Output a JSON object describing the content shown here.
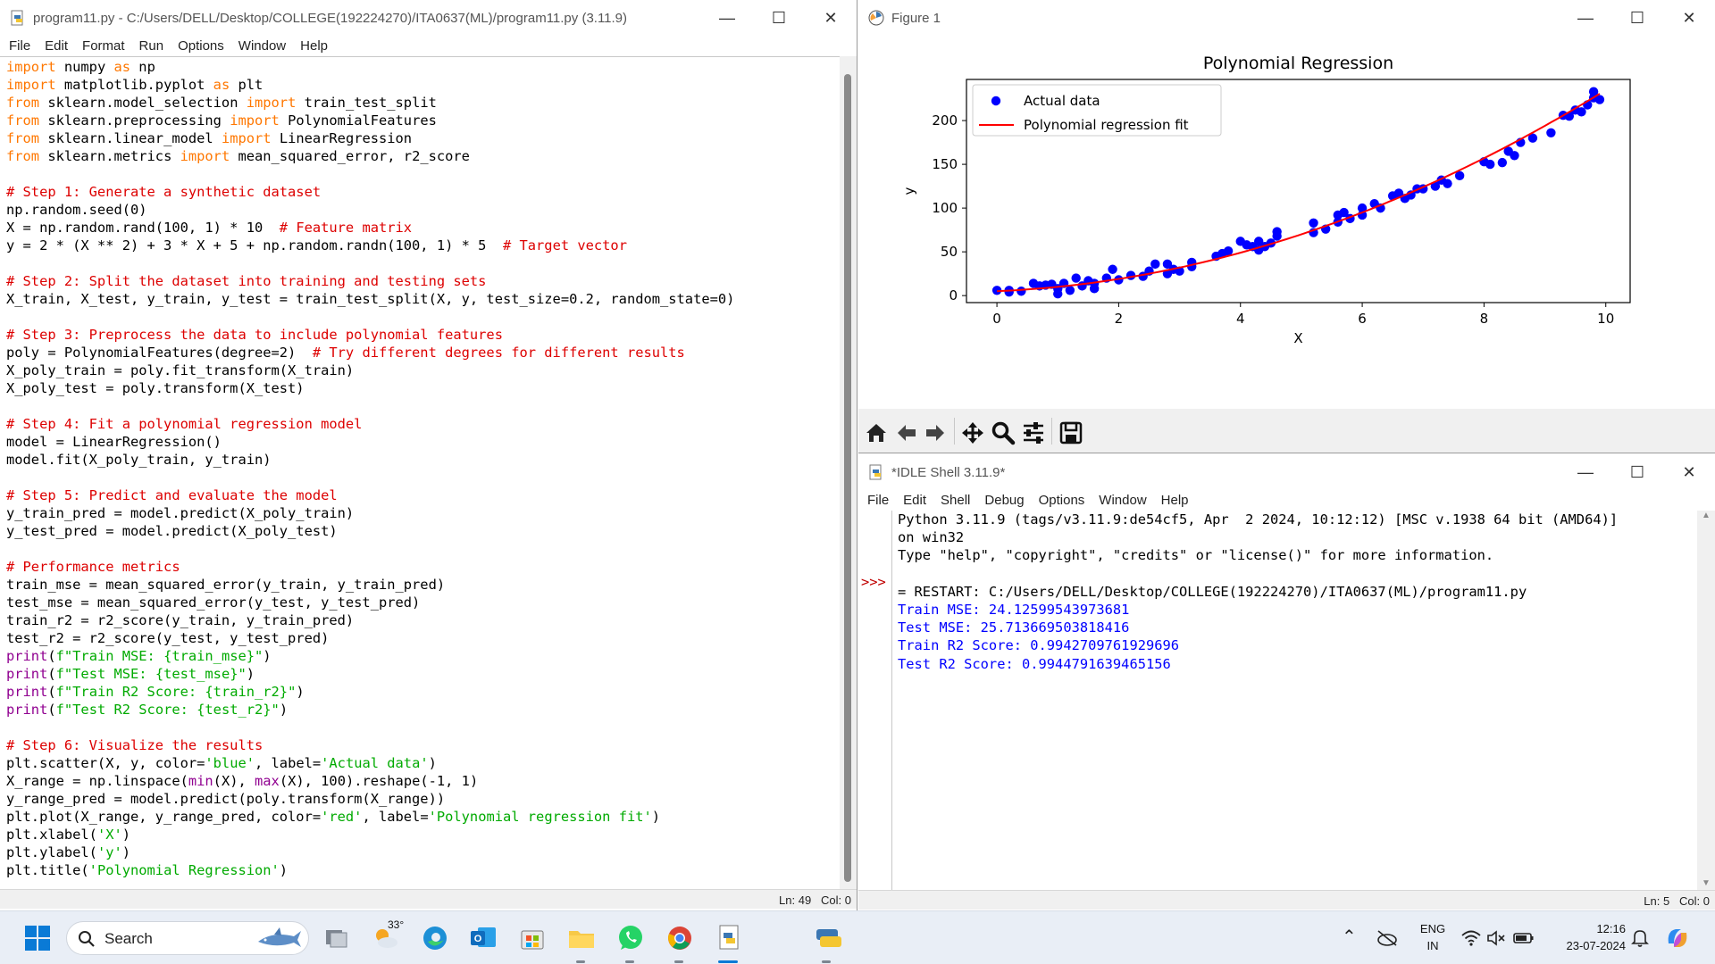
{
  "editor": {
    "title": "program11.py - C:/Users/DELL/Desktop/COLLEGE(192224270)/ITA0637(ML)/program11.py (3.11.9)",
    "menu": [
      "File",
      "Edit",
      "Format",
      "Run",
      "Options",
      "Window",
      "Help"
    ],
    "status": "Ln: 49   Col: 0",
    "code_lines": [
      [
        [
          "kw",
          "import"
        ],
        [
          "n",
          " numpy "
        ],
        [
          "kw",
          "as"
        ],
        [
          "n",
          " np"
        ]
      ],
      [
        [
          "kw",
          "import"
        ],
        [
          "n",
          " matplotlib.pyplot "
        ],
        [
          "kw",
          "as"
        ],
        [
          "n",
          " plt"
        ]
      ],
      [
        [
          "kw",
          "from"
        ],
        [
          "n",
          " sklearn.model_selection "
        ],
        [
          "kw",
          "import"
        ],
        [
          "n",
          " train_test_split"
        ]
      ],
      [
        [
          "kw",
          "from"
        ],
        [
          "n",
          " sklearn.preprocessing "
        ],
        [
          "kw",
          "import"
        ],
        [
          "n",
          " PolynomialFeatures"
        ]
      ],
      [
        [
          "kw",
          "from"
        ],
        [
          "n",
          " sklearn.linear_model "
        ],
        [
          "kw",
          "import"
        ],
        [
          "n",
          " LinearRegression"
        ]
      ],
      [
        [
          "kw",
          "from"
        ],
        [
          "n",
          " sklearn.metrics "
        ],
        [
          "kw",
          "import"
        ],
        [
          "n",
          " mean_squared_error, r2_score"
        ]
      ],
      [],
      [
        [
          "cm",
          "# Step 1: Generate a synthetic dataset"
        ]
      ],
      [
        [
          "n",
          "np.random.seed(0)"
        ]
      ],
      [
        [
          "n",
          "X = np.random.rand(100, 1) * 10  "
        ],
        [
          "cm",
          "# Feature matrix"
        ]
      ],
      [
        [
          "n",
          "y = 2 * (X ** 2) + 3 * X + 5 + np.random.randn(100, 1) * 5  "
        ],
        [
          "cm",
          "# Target vector"
        ]
      ],
      [],
      [
        [
          "cm",
          "# Step 2: Split the dataset into training and testing sets"
        ]
      ],
      [
        [
          "n",
          "X_train, X_test, y_train, y_test = train_test_split(X, y, test_size=0.2, random_state=0)"
        ]
      ],
      [],
      [
        [
          "cm",
          "# Step 3: Preprocess the data to include polynomial features"
        ]
      ],
      [
        [
          "n",
          "poly = PolynomialFeatures(degree=2)  "
        ],
        [
          "cm",
          "# Try different degrees for different results"
        ]
      ],
      [
        [
          "n",
          "X_poly_train = poly.fit_transform(X_train)"
        ]
      ],
      [
        [
          "n",
          "X_poly_test = poly.transform(X_test)"
        ]
      ],
      [],
      [
        [
          "cm",
          "# Step 4: Fit a polynomial regression model"
        ]
      ],
      [
        [
          "n",
          "model = LinearRegression()"
        ]
      ],
      [
        [
          "n",
          "model.fit(X_poly_train, y_train)"
        ]
      ],
      [],
      [
        [
          "cm",
          "# Step 5: Predict and evaluate the model"
        ]
      ],
      [
        [
          "n",
          "y_train_pred = model.predict(X_poly_train)"
        ]
      ],
      [
        [
          "n",
          "y_test_pred = model.predict(X_poly_test)"
        ]
      ],
      [],
      [
        [
          "cm",
          "# Performance metrics"
        ]
      ],
      [
        [
          "n",
          "train_mse = mean_squared_error(y_train, y_train_pred)"
        ]
      ],
      [
        [
          "n",
          "test_mse = mean_squared_error(y_test, y_test_pred)"
        ]
      ],
      [
        [
          "n",
          "train_r2 = r2_score(y_train, y_train_pred)"
        ]
      ],
      [
        [
          "n",
          "test_r2 = r2_score(y_test, y_test_pred)"
        ]
      ],
      [
        [
          "bi",
          "print"
        ],
        [
          "n",
          "("
        ],
        [
          "st",
          "f\"Train MSE: {train_mse}\""
        ],
        [
          "n",
          ")"
        ]
      ],
      [
        [
          "bi",
          "print"
        ],
        [
          "n",
          "("
        ],
        [
          "st",
          "f\"Test MSE: {test_mse}\""
        ],
        [
          "n",
          ")"
        ]
      ],
      [
        [
          "bi",
          "print"
        ],
        [
          "n",
          "("
        ],
        [
          "st",
          "f\"Train R2 Score: {train_r2}\""
        ],
        [
          "n",
          ")"
        ]
      ],
      [
        [
          "bi",
          "print"
        ],
        [
          "n",
          "("
        ],
        [
          "st",
          "f\"Test R2 Score: {test_r2}\""
        ],
        [
          "n",
          ")"
        ]
      ],
      [],
      [
        [
          "cm",
          "# Step 6: Visualize the results"
        ]
      ],
      [
        [
          "n",
          "plt.scatter(X, y, color="
        ],
        [
          "st",
          "'blue'"
        ],
        [
          "n",
          ", label="
        ],
        [
          "st",
          "'Actual data'"
        ],
        [
          "n",
          ")"
        ]
      ],
      [
        [
          "n",
          "X_range = np.linspace("
        ],
        [
          "bi",
          "min"
        ],
        [
          "n",
          "(X), "
        ],
        [
          "bi",
          "max"
        ],
        [
          "n",
          "(X), 100).reshape(-1, 1)"
        ]
      ],
      [
        [
          "n",
          "y_range_pred = model.predict(poly.transform(X_range))"
        ]
      ],
      [
        [
          "n",
          "plt.plot(X_range, y_range_pred, color="
        ],
        [
          "st",
          "'red'"
        ],
        [
          "n",
          ", label="
        ],
        [
          "st",
          "'Polynomial regression fit'"
        ],
        [
          "n",
          ")"
        ]
      ],
      [
        [
          "n",
          "plt.xlabel("
        ],
        [
          "st",
          "'X'"
        ],
        [
          "n",
          ")"
        ]
      ],
      [
        [
          "n",
          "plt.ylabel("
        ],
        [
          "st",
          "'y'"
        ],
        [
          "n",
          ")"
        ]
      ],
      [
        [
          "n",
          "plt.title("
        ],
        [
          "st",
          "'Polynomial Regression'"
        ],
        [
          "n",
          ")"
        ]
      ]
    ]
  },
  "figure": {
    "title": "Figure 1",
    "toolbar": [
      "home-icon",
      "back-arrow-icon",
      "forward-arrow-icon",
      "pan-icon",
      "zoom-icon",
      "configure-subplots-icon",
      "save-icon"
    ]
  },
  "chart_data": {
    "type": "scatter",
    "title": "Polynomial Regression",
    "xlabel": "X",
    "ylabel": "y",
    "xlim": [
      -0.5,
      10.4
    ],
    "ylim": [
      -8,
      247
    ],
    "xticks": [
      0,
      2,
      4,
      6,
      8,
      10
    ],
    "yticks": [
      0,
      50,
      100,
      150,
      200
    ],
    "legend_position": "top-left",
    "series": [
      {
        "name": "Actual data",
        "kind": "scatter",
        "color": "#0000ff",
        "points": [
          [
            0.0,
            6
          ],
          [
            0.2,
            4
          ],
          [
            0.2,
            6
          ],
          [
            0.4,
            5
          ],
          [
            0.6,
            14
          ],
          [
            0.7,
            11
          ],
          [
            0.8,
            12
          ],
          [
            0.9,
            13
          ],
          [
            1.0,
            2
          ],
          [
            1.0,
            8
          ],
          [
            1.1,
            14
          ],
          [
            1.2,
            6
          ],
          [
            1.3,
            20
          ],
          [
            1.4,
            11
          ],
          [
            1.5,
            17
          ],
          [
            1.6,
            14
          ],
          [
            1.6,
            8
          ],
          [
            1.8,
            20
          ],
          [
            1.9,
            30
          ],
          [
            2.0,
            18
          ],
          [
            2.2,
            23
          ],
          [
            2.4,
            22
          ],
          [
            2.5,
            28
          ],
          [
            2.6,
            36
          ],
          [
            2.8,
            36
          ],
          [
            2.8,
            25
          ],
          [
            2.9,
            30
          ],
          [
            3.0,
            28
          ],
          [
            3.2,
            33
          ],
          [
            3.2,
            38
          ],
          [
            3.6,
            45
          ],
          [
            3.7,
            48
          ],
          [
            3.8,
            51
          ],
          [
            4.0,
            62
          ],
          [
            4.1,
            58
          ],
          [
            4.2,
            56
          ],
          [
            4.3,
            52
          ],
          [
            4.3,
            62
          ],
          [
            4.4,
            56
          ],
          [
            4.5,
            60
          ],
          [
            4.6,
            68
          ],
          [
            4.6,
            73
          ],
          [
            5.2,
            83
          ],
          [
            5.2,
            72
          ],
          [
            5.4,
            76
          ],
          [
            5.6,
            84
          ],
          [
            5.6,
            92
          ],
          [
            5.7,
            95
          ],
          [
            5.8,
            88
          ],
          [
            6.0,
            92
          ],
          [
            6.0,
            100
          ],
          [
            6.2,
            105
          ],
          [
            6.3,
            100
          ],
          [
            6.5,
            114
          ],
          [
            6.6,
            117
          ],
          [
            6.7,
            111
          ],
          [
            6.8,
            115
          ],
          [
            6.9,
            122
          ],
          [
            7.0,
            122
          ],
          [
            7.2,
            125
          ],
          [
            7.3,
            132
          ],
          [
            7.4,
            128
          ],
          [
            7.6,
            137
          ],
          [
            8.0,
            153
          ],
          [
            8.1,
            150
          ],
          [
            8.3,
            152
          ],
          [
            8.4,
            165
          ],
          [
            8.5,
            160
          ],
          [
            8.6,
            175
          ],
          [
            8.8,
            180
          ],
          [
            9.1,
            186
          ],
          [
            9.3,
            206
          ],
          [
            9.4,
            205
          ],
          [
            9.5,
            212
          ],
          [
            9.6,
            210
          ],
          [
            9.7,
            218
          ],
          [
            9.8,
            226
          ],
          [
            9.8,
            233
          ],
          [
            9.9,
            224
          ]
        ]
      },
      {
        "name": "Polynomial regression fit",
        "kind": "line",
        "color": "#ff0000",
        "formula": "2*x^2 + 3*x + 5"
      }
    ]
  },
  "shell": {
    "title": "*IDLE Shell 3.11.9*",
    "menu": [
      "File",
      "Edit",
      "Shell",
      "Debug",
      "Options",
      "Window",
      "Help"
    ],
    "prompt": ">>>",
    "lines": [
      [
        "n",
        "Python 3.11.9 (tags/v3.11.9:de54cf5, Apr  2 2024, 10:12:12) [MSC v.1938 64 bit (AMD64)]"
      ],
      [
        "n",
        "on win32"
      ],
      [
        "n",
        "Type \"help\", \"copyright\", \"credits\" or \"license()\" for more information."
      ],
      [
        "n",
        ""
      ],
      [
        "n",
        "= RESTART: C:/Users/DELL/Desktop/COLLEGE(192224270)/ITA0637(ML)/program11.py"
      ],
      [
        "out",
        "Train MSE: 24.12599543973681"
      ],
      [
        "out",
        "Test MSE: 25.713669503818416"
      ],
      [
        "out",
        "Train R2 Score: 0.9942709761929696"
      ],
      [
        "out",
        "Test R2 Score: 0.9944791639465156"
      ]
    ],
    "status": "Ln: 5   Col: 0"
  },
  "taskbar": {
    "search_placeholder": "Search",
    "weather": "33°",
    "lang_top": "ENG",
    "lang_bottom": "IN",
    "time": "12:16",
    "date": "23-07-2024"
  }
}
